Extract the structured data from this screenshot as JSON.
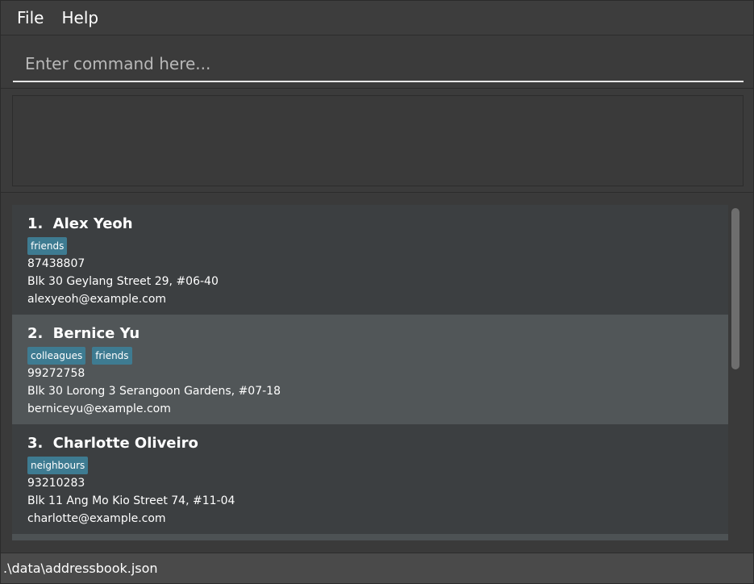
{
  "menu": {
    "file_label": "File",
    "help_label": "Help"
  },
  "command": {
    "placeholder": "Enter command here...",
    "value": ""
  },
  "result": {
    "text": ""
  },
  "persons": [
    {
      "index": "1.",
      "name": "Alex Yeoh",
      "tags": [
        "friends"
      ],
      "phone": "87438807",
      "address": "Blk 30 Geylang Street 29, #06-40",
      "email": "alexyeoh@example.com"
    },
    {
      "index": "2.",
      "name": "Bernice Yu",
      "tags": [
        "colleagues",
        "friends"
      ],
      "phone": "99272758",
      "address": "Blk 30 Lorong 3 Serangoon Gardens, #07-18",
      "email": "berniceyu@example.com"
    },
    {
      "index": "3.",
      "name": "Charlotte Oliveiro",
      "tags": [
        "neighbours"
      ],
      "phone": "93210283",
      "address": "Blk 11 Ang Mo Kio Street 74, #11-04",
      "email": "charlotte@example.com"
    }
  ],
  "status": {
    "file_path": ".\\data\\addressbook.json"
  },
  "colors": {
    "background": "#3a3a3a",
    "card_odd": "#3c3f41",
    "card_selected": "#515658",
    "tag": "#3e7b91"
  }
}
